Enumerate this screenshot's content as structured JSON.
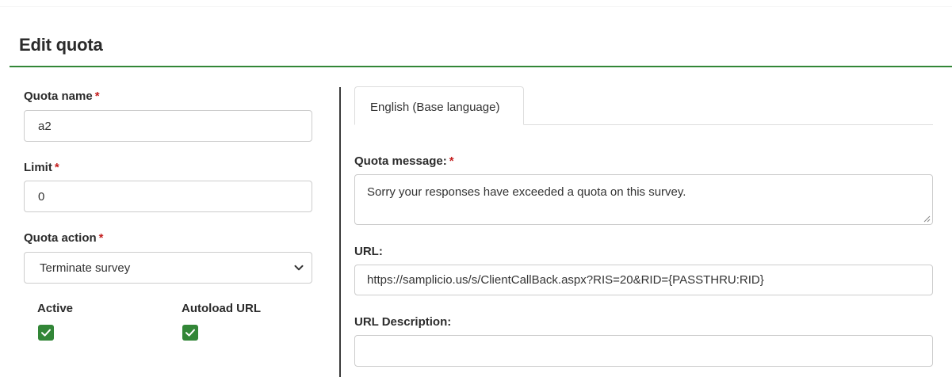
{
  "page": {
    "title": "Edit quota"
  },
  "form": {
    "quota_name": {
      "label": "Quota name",
      "required_mark": "*",
      "value": "a2"
    },
    "limit": {
      "label": "Limit",
      "required_mark": "*",
      "value": "0"
    },
    "quota_action": {
      "label": "Quota action",
      "required_mark": "*",
      "selected": "Terminate survey"
    },
    "active": {
      "label": "Active",
      "checked": true
    },
    "autoload_url": {
      "label": "Autoload URL",
      "checked": true
    }
  },
  "language_panel": {
    "tabs": [
      {
        "label": "English (Base language)",
        "active": true
      }
    ],
    "quota_message": {
      "label": "Quota message:",
      "required_mark": "*",
      "value": "Sorry your responses have exceeded a quota on this survey."
    },
    "url": {
      "label": "URL:",
      "value": "https://samplicio.us/s/ClientCallBack.aspx?RIS=20&RID={PASSTHRU:RID}"
    },
    "url_description": {
      "label": "URL Description:",
      "value": ""
    }
  },
  "colors": {
    "accent": "#328637",
    "required": "#c41e1e",
    "border": "#cccccc",
    "divider": "#3a3a3a"
  },
  "icons": {
    "select_chevron": "chevron-down-icon",
    "checkbox_check": "checkmark-icon",
    "textarea_resize": "resize-grip-icon"
  }
}
